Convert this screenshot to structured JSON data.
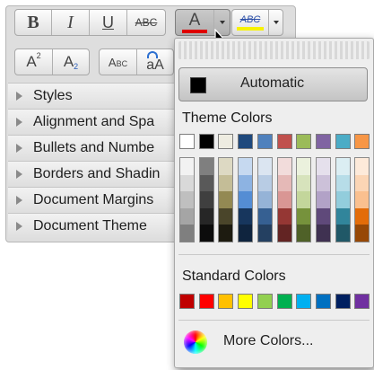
{
  "toolbar": {
    "bold_label": "B",
    "italic_label": "I",
    "underline_label": "U",
    "strike_label": "ABC",
    "font_color_label": "A",
    "font_color_bar": "#e00000",
    "highlight_label": "ABC",
    "highlight_bar": "#f7f200",
    "superscript_label": "A",
    "superscript_mark": "2",
    "subscript_label": "A",
    "subscript_mark": "2",
    "smallcaps_label": "Abc",
    "change_case_label": "aA"
  },
  "sections": [
    {
      "label": "Styles"
    },
    {
      "label": "Alignment and Spa"
    },
    {
      "label": "Bullets and Numbe"
    },
    {
      "label": "Borders and Shadin"
    },
    {
      "label": "Document Margins"
    },
    {
      "label": "Document Theme"
    }
  ],
  "popup": {
    "automatic_label": "Automatic",
    "automatic_color": "#000000",
    "theme_title": "Theme Colors",
    "theme_top": [
      "#ffffff",
      "#000000",
      "#eeece1",
      "#1f497d",
      "#4f81bd",
      "#c0504d",
      "#9bbb59",
      "#8064a2",
      "#4bacc6",
      "#f79646"
    ],
    "theme_columns": [
      [
        "#f2f2f2",
        "#d9d9d9",
        "#bfbfbf",
        "#a5a5a5",
        "#7f7f7f"
      ],
      [
        "#7f7f7f",
        "#595959",
        "#3f3f3f",
        "#262626",
        "#0c0c0c"
      ],
      [
        "#ddd9c3",
        "#c4bd97",
        "#938953",
        "#4a452a",
        "#1d1b10"
      ],
      [
        "#c6d9f0",
        "#8db3e2",
        "#548dd4",
        "#17365d",
        "#0f243e"
      ],
      [
        "#dbe5f1",
        "#b8cce4",
        "#95b3d7",
        "#366092",
        "#244061"
      ],
      [
        "#f2dcdb",
        "#e5b9b7",
        "#d99694",
        "#953734",
        "#632423"
      ],
      [
        "#ebf1dd",
        "#d7e3bc",
        "#c3d69b",
        "#76923c",
        "#4f6128"
      ],
      [
        "#e5e0ec",
        "#ccc1d9",
        "#b2a2c7",
        "#5f497a",
        "#3f3151"
      ],
      [
        "#dbeef3",
        "#b7dde8",
        "#92cddc",
        "#31859b",
        "#205867"
      ],
      [
        "#fdeada",
        "#fbd5b5",
        "#fac08f",
        "#e36c09",
        "#974806"
      ]
    ],
    "standard_title": "Standard Colors",
    "standard": [
      "#c00000",
      "#ff0000",
      "#ffc000",
      "#ffff00",
      "#92d050",
      "#00b050",
      "#00b0f0",
      "#0070c0",
      "#002060",
      "#7030a0"
    ],
    "more_label": "More Colors..."
  }
}
